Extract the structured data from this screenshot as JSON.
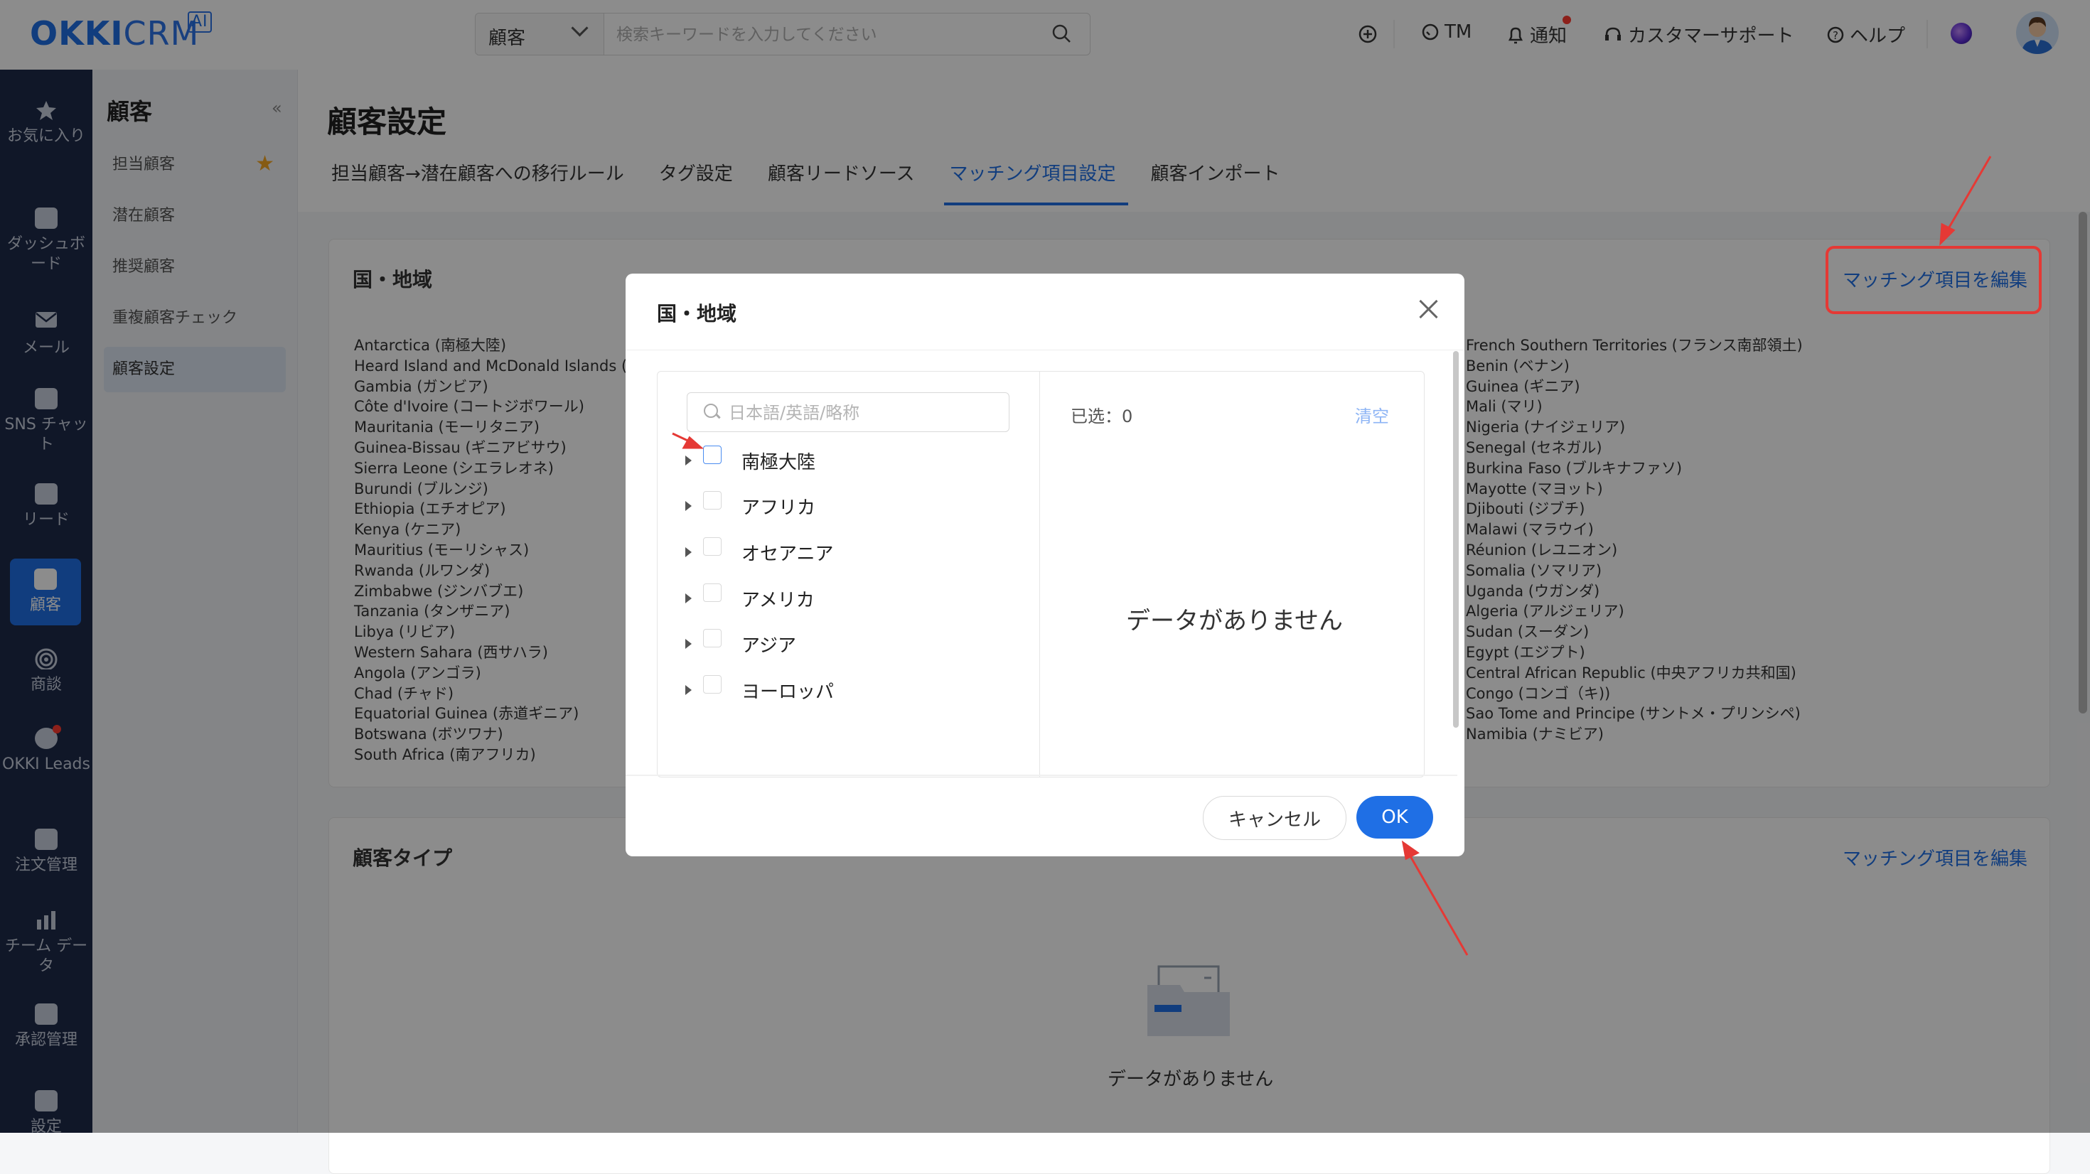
{
  "app": {
    "logo": "OKKI",
    "logo_crm": "CRM",
    "logo_ai": "AI"
  },
  "topbar": {
    "search_scope": "顧客",
    "search_placeholder": "検索キーワードを入力してください",
    "items": [
      {
        "label": "TM"
      },
      {
        "label": "通知"
      },
      {
        "label": "カスタマーサポート"
      },
      {
        "label": "ヘルプ"
      }
    ]
  },
  "leftnav": [
    {
      "label": "お気に入り",
      "icon": "star-icon"
    },
    {
      "label": "ダッシュボード",
      "icon": "dashboard-icon"
    },
    {
      "label": "メール",
      "icon": "mail-icon"
    },
    {
      "label": "SNS チャット",
      "icon": "chat-icon"
    },
    {
      "label": "リード",
      "icon": "lead-icon"
    },
    {
      "label": "顧客",
      "icon": "customers-icon",
      "active": true
    },
    {
      "label": "商談",
      "icon": "target-icon"
    },
    {
      "label": "OKKI Leads",
      "icon": "okki-leads-icon"
    },
    {
      "label": "注文管理",
      "icon": "order-icon"
    },
    {
      "label": "チーム データ",
      "icon": "chart-icon"
    },
    {
      "label": "承認管理",
      "icon": "approval-icon"
    },
    {
      "label": "設定",
      "icon": "settings-icon"
    }
  ],
  "subnav": {
    "title": "顧客",
    "collapse_icon": "«",
    "items": [
      {
        "label": "担当顧客",
        "starred": true
      },
      {
        "label": "潜在顧客"
      },
      {
        "label": "推奨顧客"
      },
      {
        "label": "重複顧客チェック"
      },
      {
        "label": "顧客設定",
        "active": true
      }
    ]
  },
  "main": {
    "title": "顧客設定",
    "tabs": [
      {
        "label": "担当顧客→潜在顧客への移行ルール"
      },
      {
        "label": "タグ設定"
      },
      {
        "label": "顧客リードソース"
      },
      {
        "label": "マッチング項目設定",
        "active": true
      },
      {
        "label": "顧客インポート"
      }
    ]
  },
  "region_card": {
    "title": "国・地域",
    "edit_label": "マッチング項目を編集",
    "left_column": [
      "Antarctica (南極大陸)",
      "Heard Island and McDonald Islands (ハ",
      "Gambia (ガンビア)",
      "Côte d'Ivoire (コートジボワール)",
      "Mauritania (モーリタニア)",
      "Guinea-Bissau (ギニアビサウ)",
      "Sierra Leone (シエラレオネ)",
      "Burundi (ブルンジ)",
      "Ethiopia (エチオピア)",
      "Kenya (ケニア)",
      "Mauritius (モーリシャス)",
      "Rwanda (ルワンダ)",
      "Zimbabwe (ジンバブエ)",
      "Tanzania (タンザニア)",
      "Libya (リビア)",
      "Western Sahara (西サハラ)",
      "Angola (アンゴラ)",
      "Chad (チャド)",
      "Equatorial Guinea (赤道ギニア)",
      "Botswana (ボツワナ)",
      "South Africa (南アフリカ)"
    ],
    "right_column": [
      "French Southern Territories (フランス南部領土)",
      "Benin (ベナン)",
      "Guinea (ギニア)",
      "Mali (マリ)",
      "Nigeria (ナイジェリア)",
      "Senegal (セネガル)",
      "Burkina Faso (ブルキナファソ)",
      "Mayotte (マヨット)",
      "Djibouti (ジブチ)",
      "Malawi (マラウイ)",
      "Réunion (レユニオン)",
      "Somalia (ソマリア)",
      "Uganda (ウガンダ)",
      "Algeria (アルジェリア)",
      "Sudan (スーダン)",
      "Egypt (エジプト)",
      "Central African Republic (中央アフリカ共和国)",
      "Congo (コンゴ（キ))",
      "Sao Tome and Principe (サントメ・プリンシペ)",
      "Namibia (ナミビア)"
    ]
  },
  "type_card": {
    "title": "顧客タイプ",
    "edit_label": "マッチング項目を編集",
    "empty_text": "データがありません"
  },
  "modal": {
    "title": "国・地域",
    "search_placeholder": "日本語/英語/略称",
    "tree": [
      {
        "label": "南極大陸"
      },
      {
        "label": "アフリカ"
      },
      {
        "label": "オセアニア"
      },
      {
        "label": "アメリカ"
      },
      {
        "label": "アジア"
      },
      {
        "label": "ヨーロッパ"
      }
    ],
    "selected_label": "已选：0",
    "clear_label": "清空",
    "empty_text": "データがありません",
    "cancel_label": "キャンセル",
    "ok_label": "OK"
  },
  "colors": {
    "brand": "#1f6fe5",
    "nav_bg": "#1e2a4a",
    "annotation": "#e53935"
  }
}
